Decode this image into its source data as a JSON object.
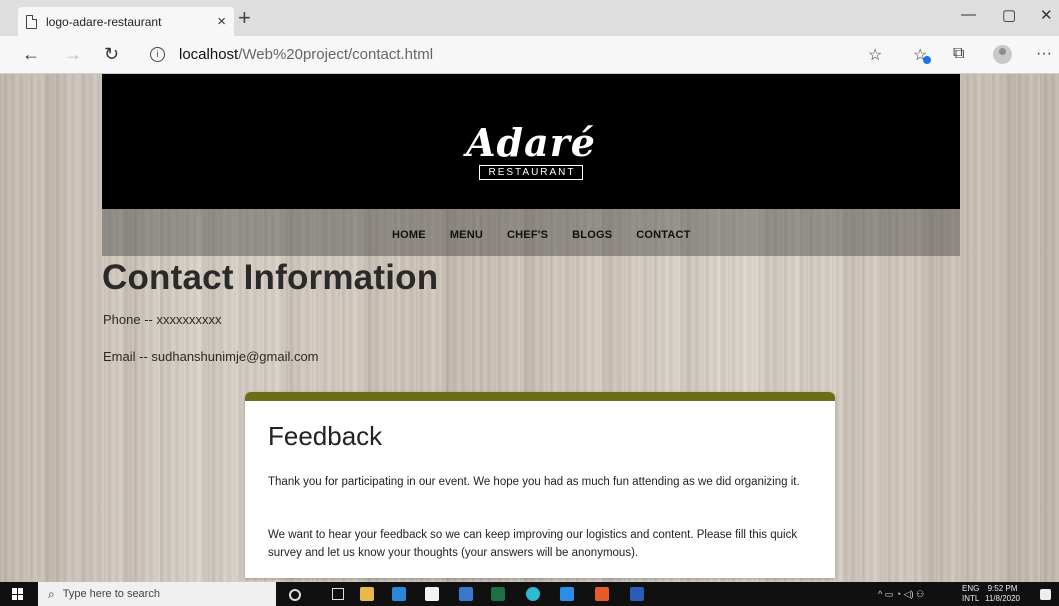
{
  "browser": {
    "tab_title": "logo-adare-restaurant",
    "tab_close": "×",
    "new_tab": "+",
    "url_host": "localhost",
    "url_path": "/Web%20project/contact.html",
    "minimize": "—",
    "restore": "▢",
    "close": "✕",
    "back": "←",
    "forward": "→",
    "refresh": "↻",
    "info": "i",
    "star": "☆",
    "favorites": "☆",
    "collections": "⧉",
    "more": "···"
  },
  "site": {
    "logo_word": "Adaré",
    "logo_tag": "RESTAURANT",
    "nav": [
      "HOME",
      "MENU",
      "CHEF'S",
      "BLOGS",
      "CONTACT"
    ]
  },
  "contact": {
    "title": "Contact Information",
    "phone_label": "Phone --",
    "phone_value": "xxxxxxxxxx",
    "email_label": "Email --",
    "email_value": "sudhanshunimje@gmail.com"
  },
  "feedback": {
    "title": "Feedback",
    "para1": "Thank you for participating in our event. We hope you had as much fun attending as we did organizing it.",
    "para2": "We want to hear your feedback so we can keep improving our logistics and content. Please fill this quick survey and let us know your thoughts (your answers will be anonymous).",
    "accent_color": "#6b6e16"
  },
  "taskbar": {
    "search_placeholder": "Type here to search",
    "lang_top": "ENG",
    "lang_bottom": "INTL",
    "time": "9:52 PM",
    "date": "11/8/2020"
  }
}
